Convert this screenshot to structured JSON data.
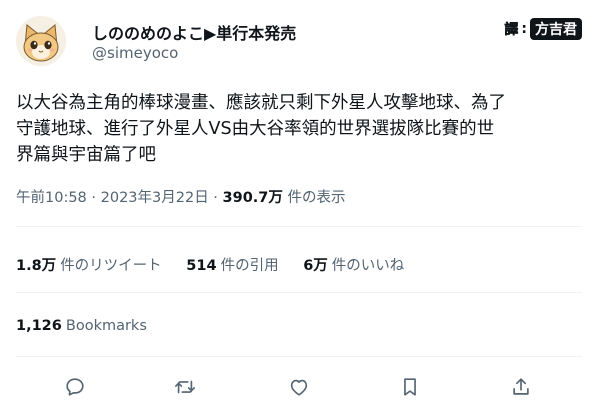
{
  "author": {
    "display_name": "しののめのよこ▶単行本発売",
    "handle": "@simeyoco",
    "avatar_icon": "cat-avatar-icon"
  },
  "translator_stamp": {
    "label": "譯",
    "name": "方吉君"
  },
  "tweet": {
    "text": "以大谷為主角的棒球漫畫、應該就只剩下外星人攻擊地球、為了\n守護地球、進行了外星人VS由大谷率領的世界選拔隊比賽的世\n界篇與宇宙篇了吧"
  },
  "meta": {
    "timestamp": "午前10:58 · 2023年3月22日 · ",
    "views_count": "390.7万",
    "views_label": " 件の表示"
  },
  "stats": {
    "retweets_count": "1.8万",
    "retweets_label": "件のリツイート",
    "quotes_count": "514",
    "quotes_label": "件の引用",
    "likes_count": "6万",
    "likes_label": "件のいいね"
  },
  "bookmarks": {
    "count": "1,126",
    "label": "Bookmarks"
  },
  "actions": {
    "reply_icon": "reply-icon",
    "retweet_icon": "retweet-icon",
    "like_icon": "heart-icon",
    "bookmark_icon": "bookmark-icon",
    "share_icon": "share-icon",
    "icon_color": "#536471"
  }
}
